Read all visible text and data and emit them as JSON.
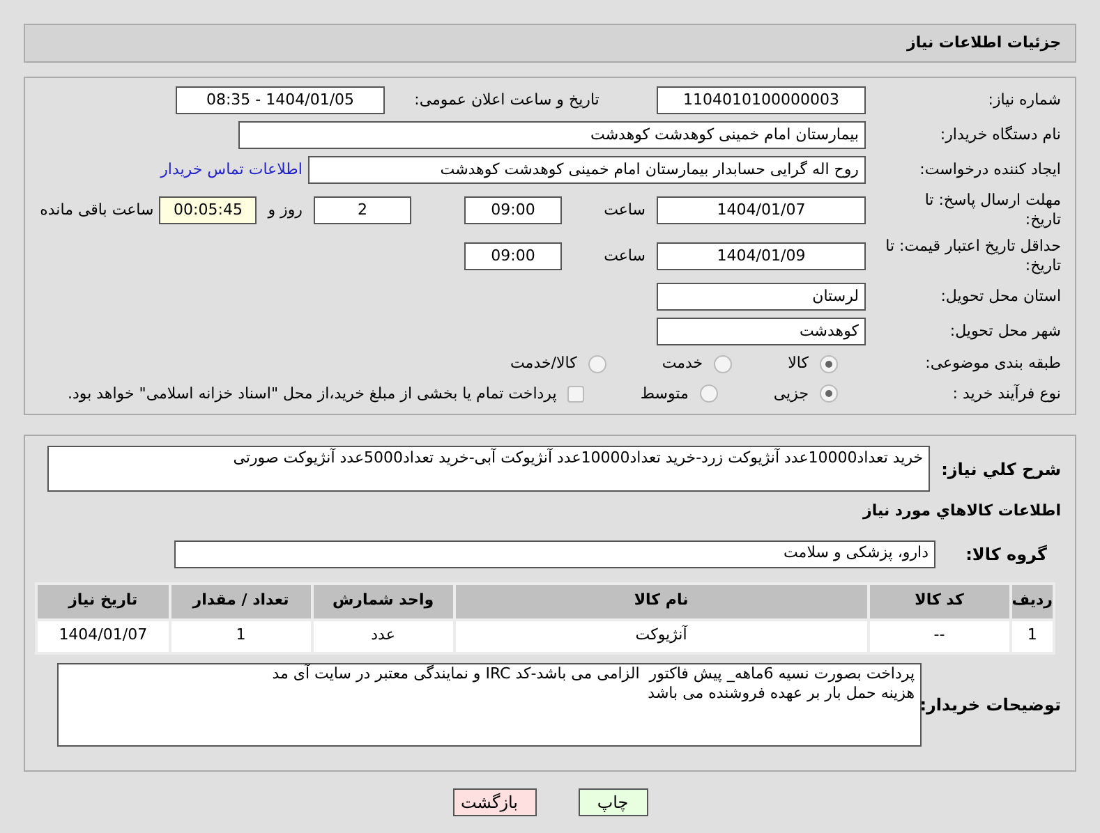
{
  "header": {
    "title": "جزئیات اطلاعات نیاز"
  },
  "need_number": {
    "label": "شماره نیاز:",
    "value": "1104010100000003"
  },
  "announce": {
    "label": "تاریخ و ساعت اعلان عمومی:",
    "value": "1404/01/05 - 08:35"
  },
  "buyer": {
    "label": "نام دستگاه خریدار:",
    "value": "بیمارستان امام خمینی کوهدشت کوهدشت"
  },
  "creator": {
    "label": "ایجاد کننده درخواست:",
    "value": "روح اله گرایی حسابدار بیمارستان امام خمینی کوهدشت کوهدشت",
    "link": "اطلاعات تماس خریدار"
  },
  "deadline": {
    "label": "مهلت ارسال پاسخ: تا تاریخ:",
    "date": "1404/01/07",
    "time_label": "ساعت",
    "time": "09:00",
    "days": "2",
    "days_label": "روز و",
    "remaining": "00:05:45",
    "remaining_label": "ساعت باقی مانده"
  },
  "validity": {
    "label": "حداقل تاریخ اعتبار قیمت: تا تاریخ:",
    "date": "1404/01/09",
    "time_label": "ساعت",
    "time": "09:00"
  },
  "province": {
    "label": "استان محل تحویل:",
    "value": "لرستان"
  },
  "city": {
    "label": "شهر محل تحویل:",
    "value": "کوهدشت"
  },
  "category": {
    "label": "طبقه بندی موضوعی:",
    "options": [
      {
        "label": "کالا",
        "selected": true
      },
      {
        "label": "خدمت",
        "selected": false
      },
      {
        "label": "کالا/خدمت",
        "selected": false
      }
    ]
  },
  "process": {
    "label": "نوع فرآیند خرید :",
    "options": [
      {
        "label": "جزیی",
        "selected": true
      },
      {
        "label": "متوسط",
        "selected": false
      }
    ],
    "checkbox": {
      "label": "پرداخت تمام یا بخشی از مبلغ خرید،از محل \"اسناد خزانه اسلامی\" خواهد بود.",
      "checked": false
    }
  },
  "description": {
    "label": "شرح کلي نياز:",
    "value": "خريد تعداد10000عدد آنژیوکت زرد-خرید تعداد10000عدد آنژیوکت آبی-خرید تعداد5000عدد آنژیوکت صورتی"
  },
  "goods_title": "اطلاعات کالاهاي مورد نياز",
  "group": {
    "label": "گروه کالا:",
    "value": "دارو، پزشکی و سلامت"
  },
  "table": {
    "columns": [
      "ردیف",
      "کد کالا",
      "نام کالا",
      "واحد شمارش",
      "تعداد / مقدار",
      "تاریخ نیاز"
    ],
    "rows": [
      [
        "1",
        "--",
        "آنژیوکت",
        "عدد",
        "1",
        "1404/01/07"
      ]
    ]
  },
  "notes": {
    "label": "توضیحات خریدار:",
    "lines": [
      "پرداخت بصورت نسیه 6ماهه_ پیش فاکتور  الزامی می باشد-کد IRC و نمایندگی معتبر در سایت آی مد",
      "هزینه حمل بار بر عهده فروشنده می باشد"
    ]
  },
  "buttons": [
    {
      "label": "چاپ",
      "kind": "print"
    },
    {
      "label": "بازگشت",
      "kind": "back"
    }
  ]
}
